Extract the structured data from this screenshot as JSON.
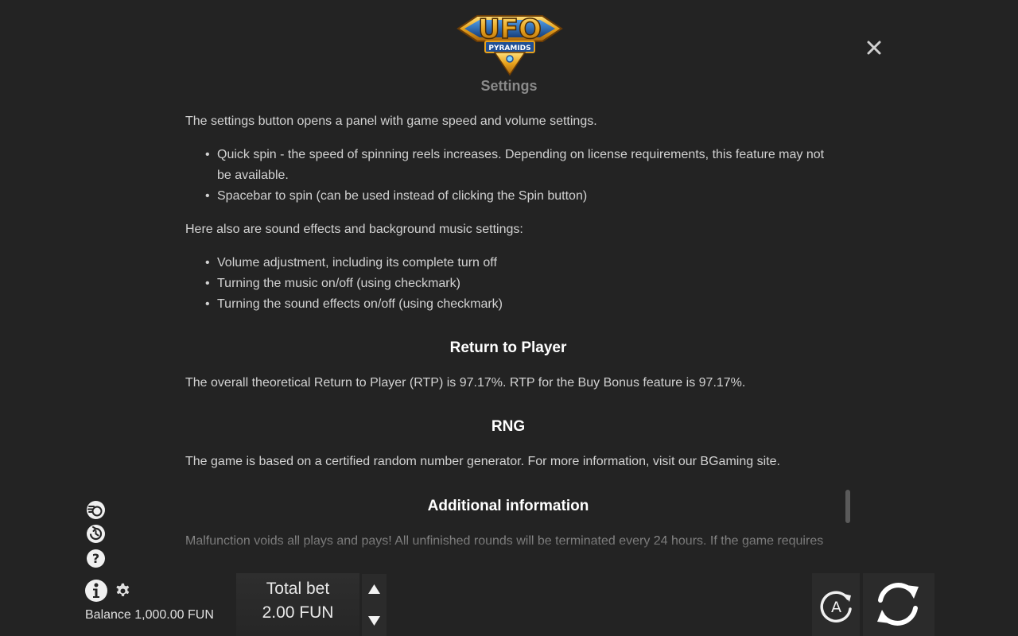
{
  "logo": {
    "title": "UFO",
    "subtitle": "PYRAMIDS"
  },
  "header": {
    "section_title": "Settings"
  },
  "content": {
    "settings_intro": "The settings button opens a panel with game speed and volume settings.",
    "settings_items": [
      "Quick spin - the speed of spinning reels increases. Depending on license requirements, this feature may not be available.",
      "Spacebar to spin (can be used instead of clicking the Spin button)"
    ],
    "sound_intro": "Here also are sound effects and background music settings:",
    "sound_items": [
      "Volume adjustment, including its complete turn off",
      "Turning the music on/off (using checkmark)",
      "Turning the sound effects on/off (using checkmark)"
    ],
    "rtp_heading": "Return to Player",
    "rtp_text": "The overall theoretical Return to Player (RTP) is 97.17%. RTP for the Buy Bonus feature is 97.17%.",
    "rng_heading": "RNG",
    "rng_text": "The game is based on a certified random number generator. For more information, visit our BGaming site.",
    "additional_heading": "Additional information",
    "additional_text": "Malfunction voids all plays and pays! All unfinished rounds will be terminated every 24 hours. If the game requires"
  },
  "footer": {
    "balance": "Balance 1,000.00 FUN",
    "bet_label": "Total bet",
    "bet_value": "2.00 FUN",
    "auto_letter": "A"
  },
  "icons": {
    "close": "close-icon",
    "coins": "coins-icon",
    "history": "history-icon",
    "help": "help-icon",
    "info": "info-icon",
    "settings": "gear-icon",
    "bet_up": "arrow-up-icon",
    "bet_down": "arrow-down-icon",
    "autoplay": "autoplay-icon",
    "spin": "spin-icon"
  },
  "colors": {
    "background": "#232323",
    "heading": "#ffffff",
    "body_text": "#d2d2d2",
    "logo_gold": "#e8a21c",
    "logo_blue": "#1f5fae"
  }
}
